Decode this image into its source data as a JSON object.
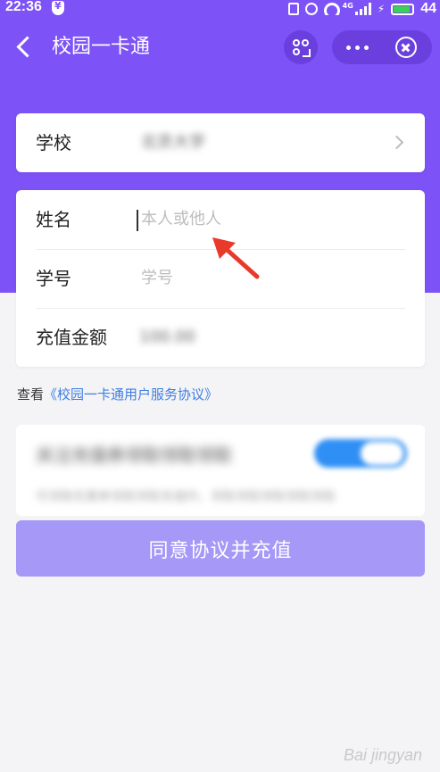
{
  "status_bar": {
    "time": "22:36",
    "network": "4G",
    "battery": "44"
  },
  "nav": {
    "title": "校园一卡通"
  },
  "school": {
    "label": "学校",
    "value": "北京大学"
  },
  "form": {
    "name_label": "姓名",
    "name_placeholder": "本人或他人",
    "id_label": "学号",
    "id_placeholder": "学号",
    "amount_label": "充值金额",
    "amount_value": "100.00"
  },
  "agreement": {
    "prefix": "查看",
    "link": "《校园一卡通用户服务协议》"
  },
  "notice": {
    "title": "关注充值券领取领取领取",
    "desc": "可领取优惠券领取领取充值时，领取领取领取领取领取"
  },
  "submit_button": "同意协议并充值",
  "watermark": "Bai jingyan",
  "colors": {
    "brand": "#7d52f6",
    "button": "#a698f7",
    "link": "#3d7de4",
    "arrow": "#e8392b"
  }
}
